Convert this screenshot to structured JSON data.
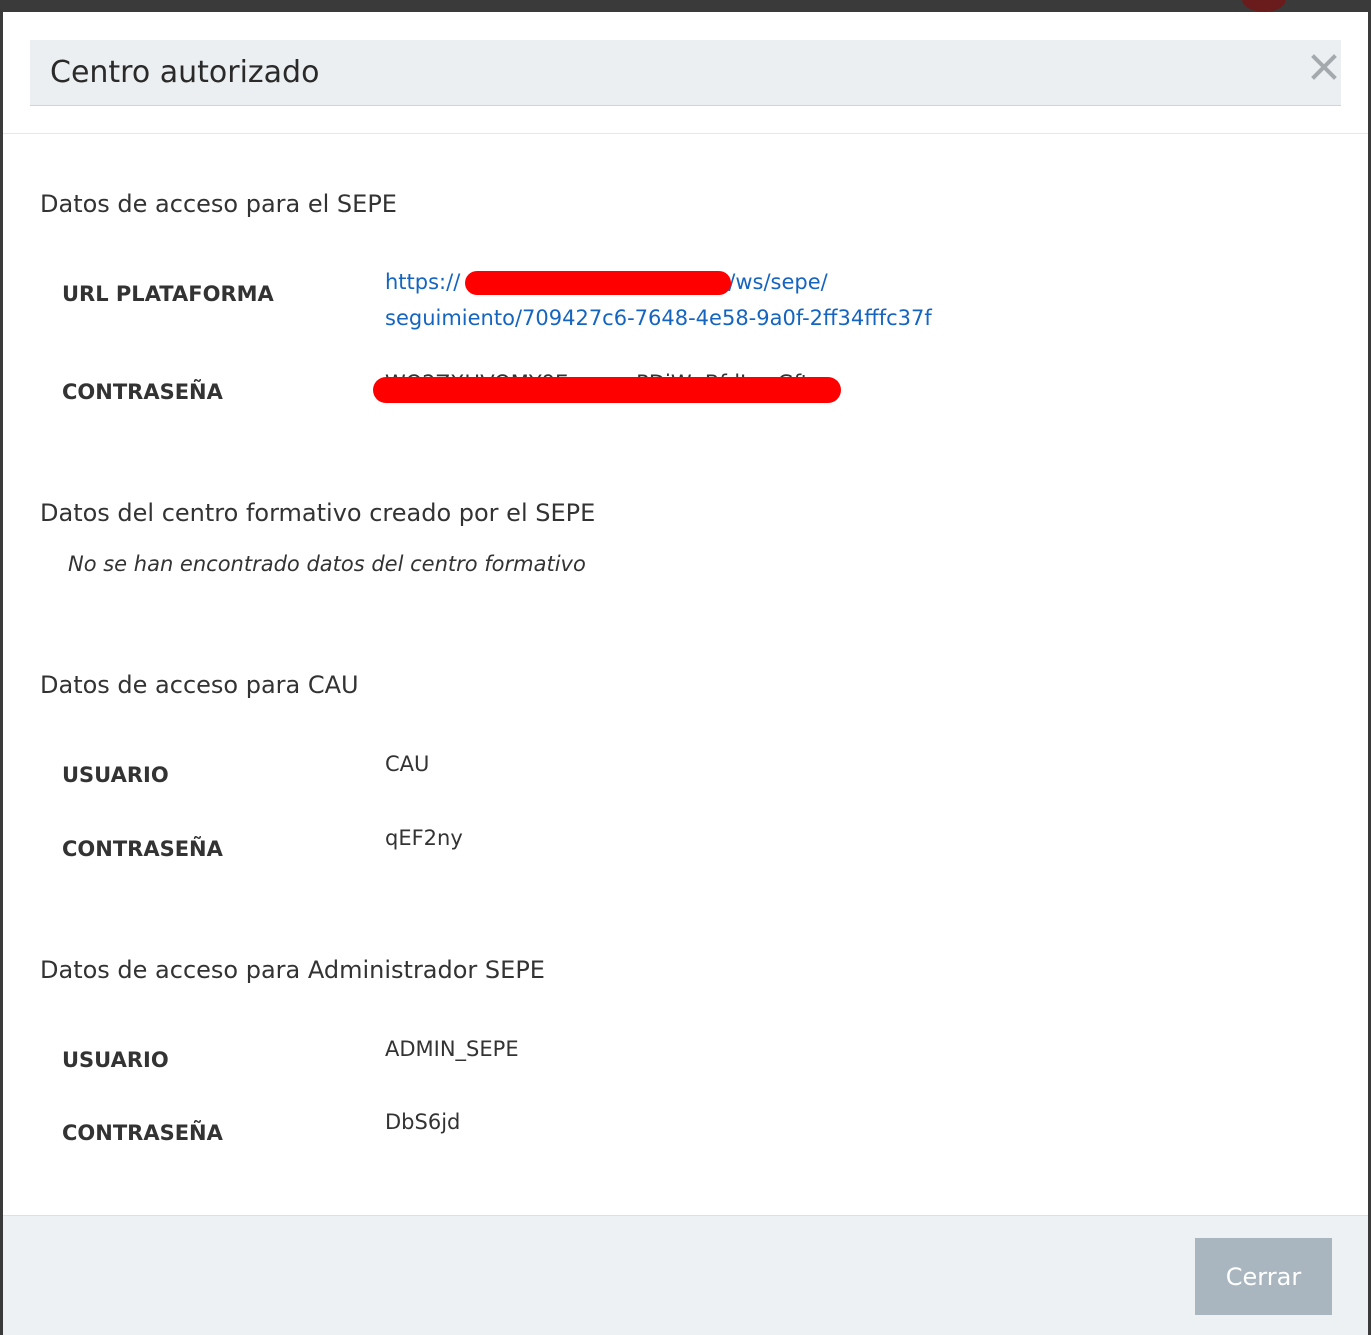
{
  "modal": {
    "title": "Centro autorizado",
    "close_icon": "close-icon"
  },
  "sepe_access": {
    "title": "Datos de acceso para el SEPE",
    "url_label": "URL PLATAFORMA",
    "url_prefix": "https://",
    "url_middle": "/ws/sepe/",
    "url_line2": "seguimiento/709427c6-7648-4e58-9a0f-2ff34fffc37f",
    "password_label": "CONTRASEÑA",
    "password_value": "WO2ZXHVOMY9EcwrwnPDiWgBfdLvuGft"
  },
  "training_center": {
    "title": "Datos del centro formativo creado por el SEPE",
    "empty_message": "No se han encontrado datos del centro formativo"
  },
  "cau_access": {
    "title": "Datos de acceso para CAU",
    "user_label": "USUARIO",
    "user_value": "CAU",
    "password_label": "CONTRASEÑA",
    "password_value": "qEF2ny"
  },
  "admin_access": {
    "title": "Datos de acceso para Administrador SEPE",
    "user_label": "USUARIO",
    "user_value": "ADMIN_SEPE",
    "password_label": "CONTRASEÑA",
    "password_value": "DbS6jd"
  },
  "footer": {
    "close_button_label": "Cerrar"
  },
  "colors": {
    "link": "#1565c0",
    "redaction": "#ff0000",
    "footer_button": "#a9b6c0"
  }
}
